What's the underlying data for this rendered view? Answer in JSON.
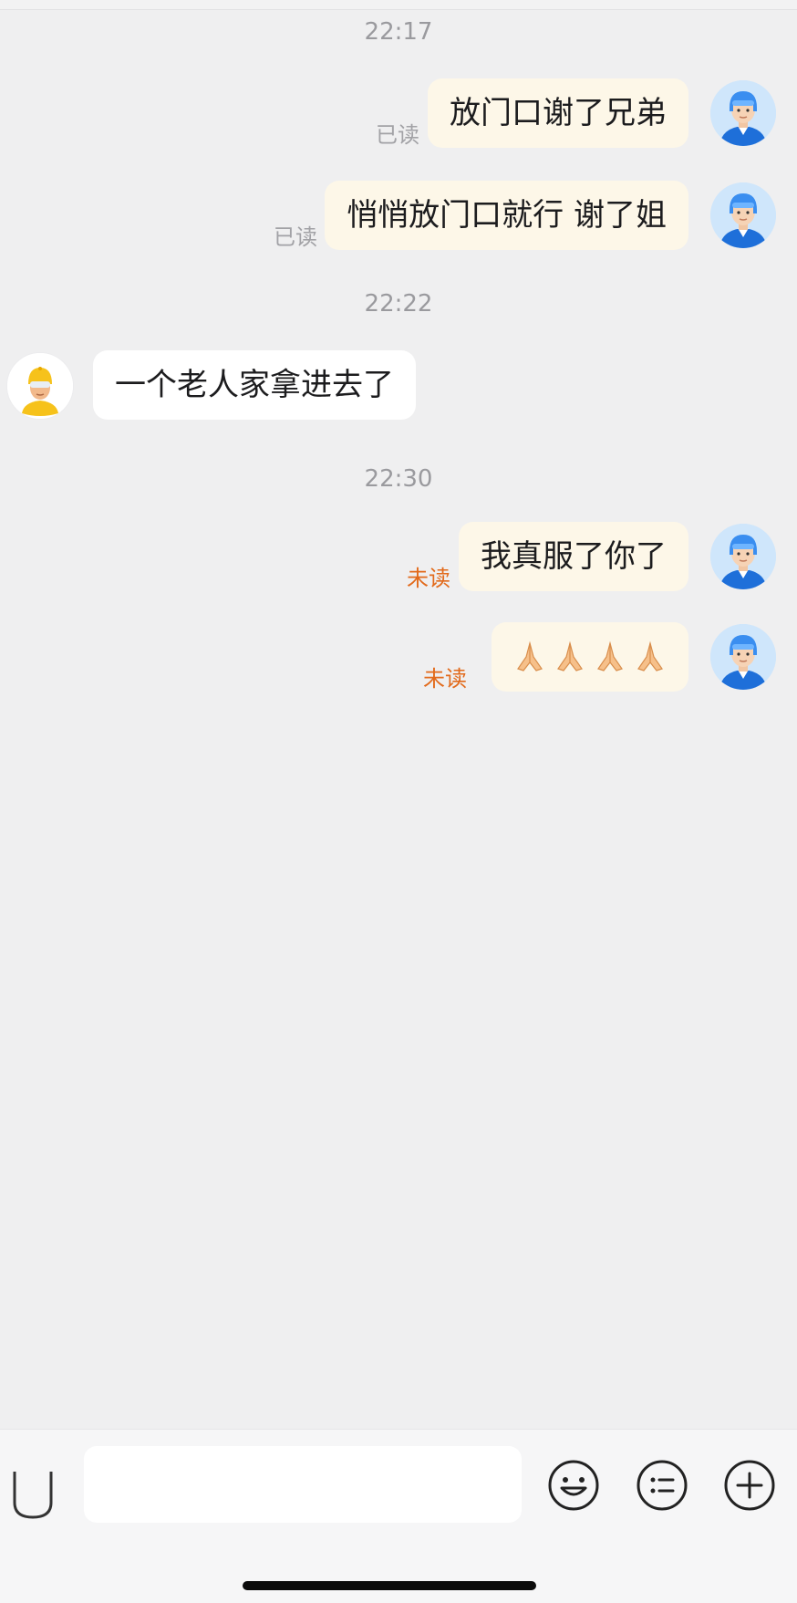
{
  "timestamps": [
    "22:17",
    "22:22",
    "22:30"
  ],
  "messages": [
    {
      "side": "me",
      "text": "放门口谢了兄弟",
      "status": "已读",
      "status_type": "read"
    },
    {
      "side": "me",
      "text": "悄悄放门口就行 谢了姐",
      "status": "已读",
      "status_type": "read"
    },
    {
      "side": "them",
      "text": "一个老人家拿进去了"
    },
    {
      "side": "me",
      "text": "我真服了你了",
      "status": "未读",
      "status_type": "unread"
    },
    {
      "side": "me",
      "emoji": "folded-hands-icon",
      "emoji_count": 4,
      "status": "未读",
      "status_type": "unread"
    }
  ],
  "input": {
    "placeholder": "",
    "value": ""
  },
  "toolbar": {
    "icons": [
      "voice-icon",
      "emoji-icon",
      "quick-reply-list-icon",
      "plus-icon"
    ]
  },
  "colors": {
    "my_bubble": "#fdf7e8",
    "their_bubble": "#ffffff",
    "unread": "#e26a1b",
    "read": "#a2a2a6",
    "background": "#efeff0"
  }
}
